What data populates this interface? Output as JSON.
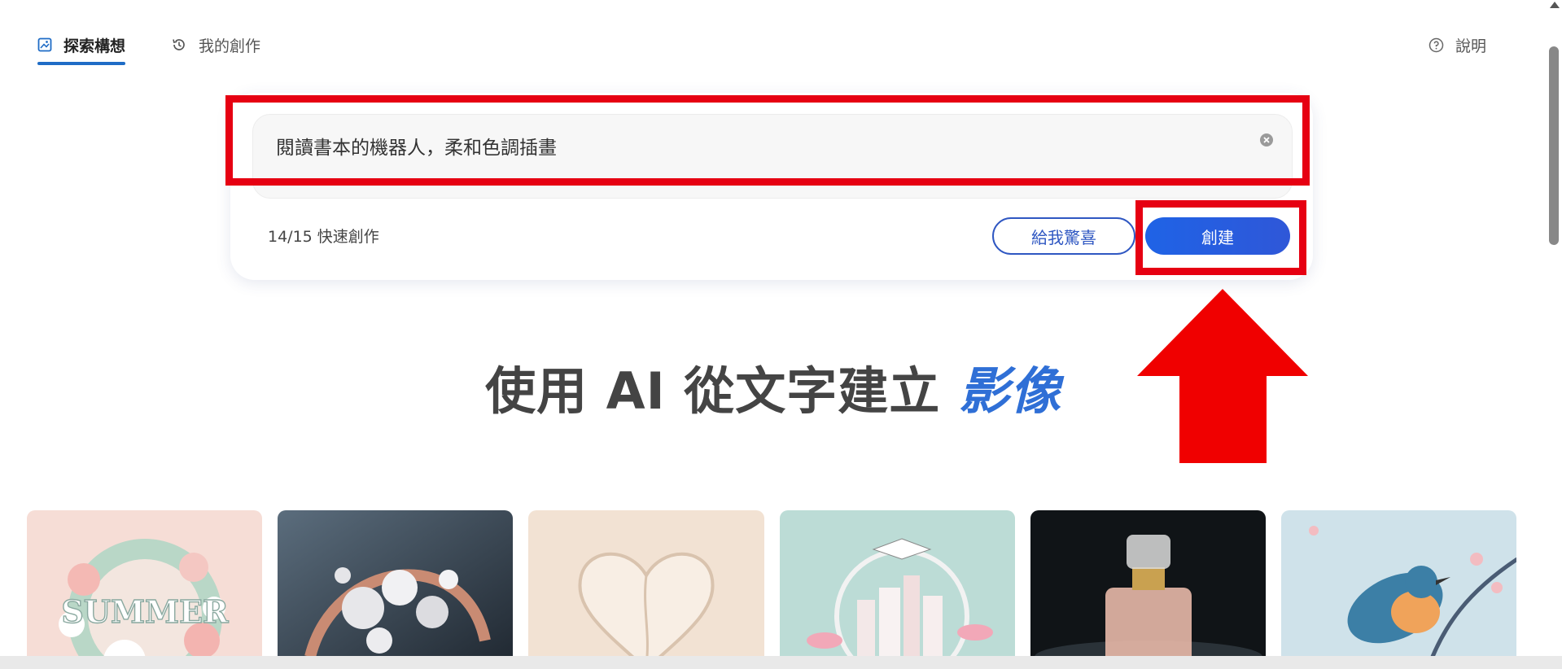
{
  "nav": {
    "tabs": [
      {
        "label": "探索構想",
        "icon": "image-icon",
        "active": true
      },
      {
        "label": "我的創作",
        "icon": "history-icon",
        "active": false
      }
    ],
    "help_label": "說明",
    "help_icon": "question-circle-icon"
  },
  "prompt": {
    "value": "閱讀書本的機器人，柔和色調插畫",
    "clear_icon": "clear-icon"
  },
  "quota_text": "14/15 快速創作",
  "buttons": {
    "surprise_label": "給我驚喜",
    "create_label": "創建"
  },
  "headline": {
    "main": "使用 AI 從文字建立 ",
    "accent": "影像"
  },
  "gallery": [
    {
      "subject": "paper-craft summer flowers",
      "text": "SUMMER"
    },
    {
      "subject": "rose gold pearl ring"
    },
    {
      "subject": "paper heart"
    },
    {
      "subject": "graduation paper city"
    },
    {
      "subject": "perfume bottle"
    },
    {
      "subject": "bird on blossom branch"
    }
  ],
  "colors": {
    "accent": "#2f6fd6",
    "create_button": "#1f63e6",
    "annotation_red": "#e60012"
  }
}
